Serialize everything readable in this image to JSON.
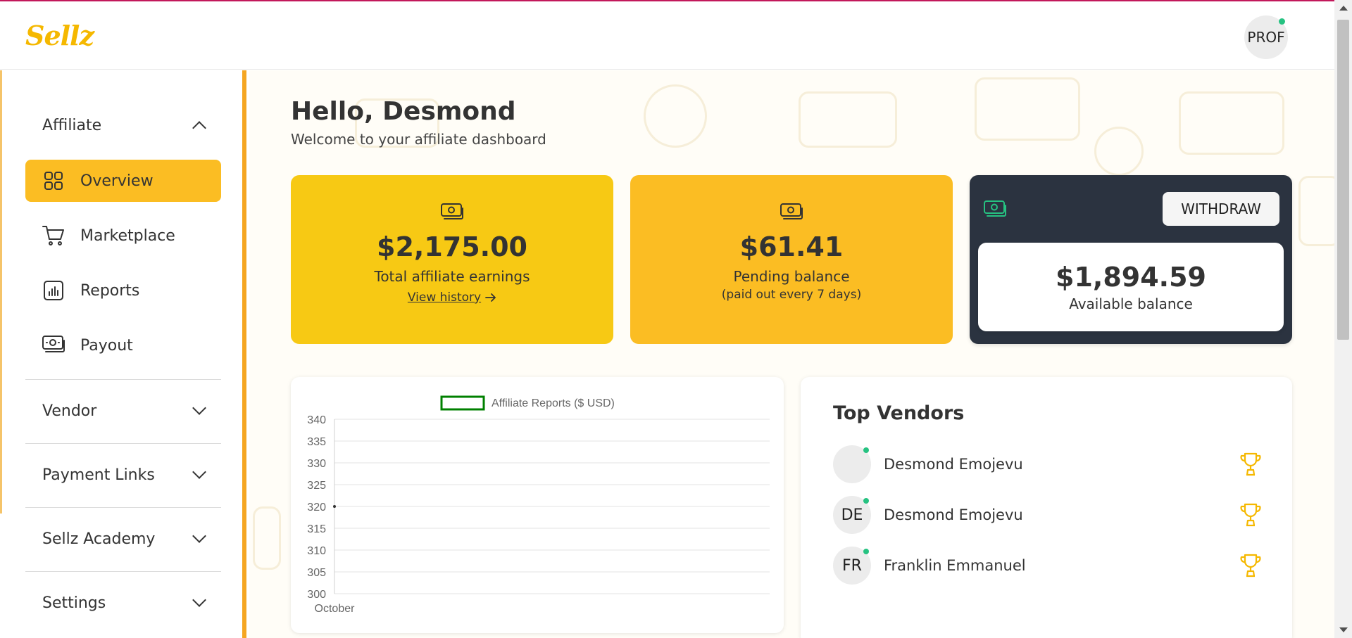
{
  "app": {
    "logo": "Sellz",
    "profile_alt": "PROF"
  },
  "colors": {
    "accent": "#fbbd23",
    "accent_yellow": "#f7c914",
    "dark": "#2b3340",
    "online": "#26c281",
    "trophy": "#f5b800"
  },
  "sidebar": {
    "affiliate": {
      "label": "Affiliate",
      "icon": "chevron-up-icon"
    },
    "items": [
      {
        "label": "Overview",
        "icon": "grid-icon",
        "active": true
      },
      {
        "label": "Marketplace",
        "icon": "cart-icon",
        "active": false
      },
      {
        "label": "Reports",
        "icon": "bar-chart-icon",
        "active": false
      },
      {
        "label": "Payout",
        "icon": "money-icon",
        "active": false
      }
    ],
    "sections": [
      {
        "label": "Vendor",
        "icon": "chevron-down-icon"
      },
      {
        "label": "Payment Links",
        "icon": "chevron-down-icon"
      },
      {
        "label": "Sellz Academy",
        "icon": "chevron-down-icon"
      },
      {
        "label": "Settings",
        "icon": "chevron-down-icon"
      }
    ]
  },
  "main": {
    "greeting": "Hello, Desmond",
    "welcome": "Welcome to your affiliate dashboard",
    "cards": {
      "earnings": {
        "amount": "$2,175.00",
        "label": "Total affiliate earnings",
        "link": "View history"
      },
      "pending": {
        "amount": "$61.41",
        "label": "Pending balance",
        "sub": "(paid out every 7 days)"
      },
      "available": {
        "amount": "$1,894.59",
        "label": "Available balance",
        "button": "WITHDRAW"
      }
    },
    "top_vendors": {
      "title": "Top Vendors",
      "vendors": [
        {
          "initials": "",
          "name": "Desmond Emojevu"
        },
        {
          "initials": "DE",
          "name": "Desmond Emojevu"
        },
        {
          "initials": "FR",
          "name": "Franklin Emmanuel"
        }
      ]
    }
  },
  "chart_data": {
    "type": "line",
    "legend": "Affiliate Reports ($ USD)",
    "legend_color": "#008000",
    "categories": [
      "October"
    ],
    "series": [
      {
        "name": "Affiliate Reports ($ USD)",
        "values": [
          320
        ]
      }
    ],
    "ylim": [
      300,
      340
    ],
    "yticks": [
      340,
      335,
      330,
      325,
      320,
      315,
      310,
      305,
      300
    ],
    "grid": true,
    "legend_position": "top"
  }
}
